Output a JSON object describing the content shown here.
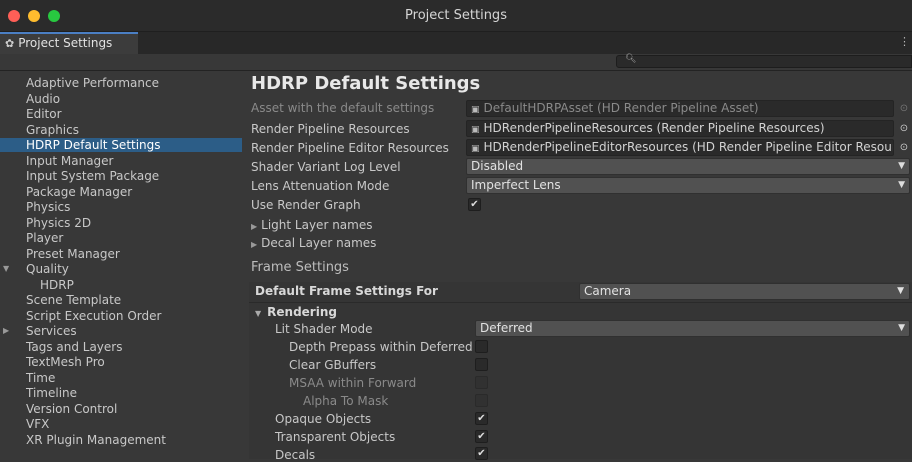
{
  "window": {
    "title": "Project Settings",
    "tab_label": "Project Settings",
    "tab_icon": "gear-icon",
    "menu_icon": "more-icon"
  },
  "search": {
    "placeholder": "",
    "icon": "search-icon"
  },
  "sidebar": {
    "items": [
      {
        "label": "Adaptive Performance"
      },
      {
        "label": "Audio"
      },
      {
        "label": "Editor"
      },
      {
        "label": "Graphics"
      },
      {
        "label": "HDRP Default Settings",
        "selected": true
      },
      {
        "label": "Input Manager"
      },
      {
        "label": "Input System Package"
      },
      {
        "label": "Package Manager"
      },
      {
        "label": "Physics"
      },
      {
        "label": "Physics 2D"
      },
      {
        "label": "Player"
      },
      {
        "label": "Preset Manager"
      },
      {
        "label": "Quality",
        "expanded": true
      },
      {
        "label": "HDRP",
        "child": true
      },
      {
        "label": "Scene Template"
      },
      {
        "label": "Script Execution Order"
      },
      {
        "label": "Services",
        "collapsed": true
      },
      {
        "label": "Tags and Layers"
      },
      {
        "label": "TextMesh Pro"
      },
      {
        "label": "Time"
      },
      {
        "label": "Timeline"
      },
      {
        "label": "Version Control"
      },
      {
        "label": "VFX"
      },
      {
        "label": "XR Plugin Management"
      }
    ]
  },
  "main": {
    "title": "HDRP Default Settings",
    "fields": {
      "default_asset": {
        "label": "Asset with the default settings",
        "value": "DefaultHDRPAsset (HD Render Pipeline Asset)"
      },
      "rp_resources": {
        "label": "Render Pipeline Resources",
        "value": "HDRenderPipelineResources (Render Pipeline Resources)"
      },
      "rp_editor_resources": {
        "label": "Render Pipeline Editor Resources",
        "value": "HDRenderPipelineEditorResources (HD Render Pipeline Editor Resources)"
      },
      "shader_log": {
        "label": "Shader Variant Log Level",
        "value": "Disabled"
      },
      "lens_atten": {
        "label": "Lens Attenuation Mode",
        "value": "Imperfect Lens"
      },
      "render_graph": {
        "label": "Use Render Graph",
        "checked": true
      }
    },
    "foldouts": {
      "light_layers": "Light Layer names",
      "decal_layers": "Decal Layer names"
    },
    "frame_settings": {
      "section_title": "Frame Settings",
      "for_label": "Default Frame Settings For",
      "for_value": "Camera",
      "rendering_label": "Rendering",
      "lit_shader_label": "Lit Shader Mode",
      "lit_shader_value": "Deferred",
      "rows": {
        "depth_prepass": {
          "label": "Depth Prepass within Deferred",
          "checked": false
        },
        "clear_gbuffers": {
          "label": "Clear GBuffers",
          "checked": false
        },
        "msaa": {
          "label": "MSAA within Forward",
          "checked": false,
          "disabled": true
        },
        "alpha_mask": {
          "label": "Alpha To Mask",
          "checked": false,
          "disabled": true
        },
        "opaque": {
          "label": "Opaque Objects",
          "checked": true
        },
        "transparent": {
          "label": "Transparent Objects",
          "checked": true
        },
        "decals": {
          "label": "Decals",
          "checked": true
        }
      }
    }
  },
  "colors": {
    "selection": "#2c5d87",
    "accent": "#4b7fc4",
    "background": "#383838"
  }
}
